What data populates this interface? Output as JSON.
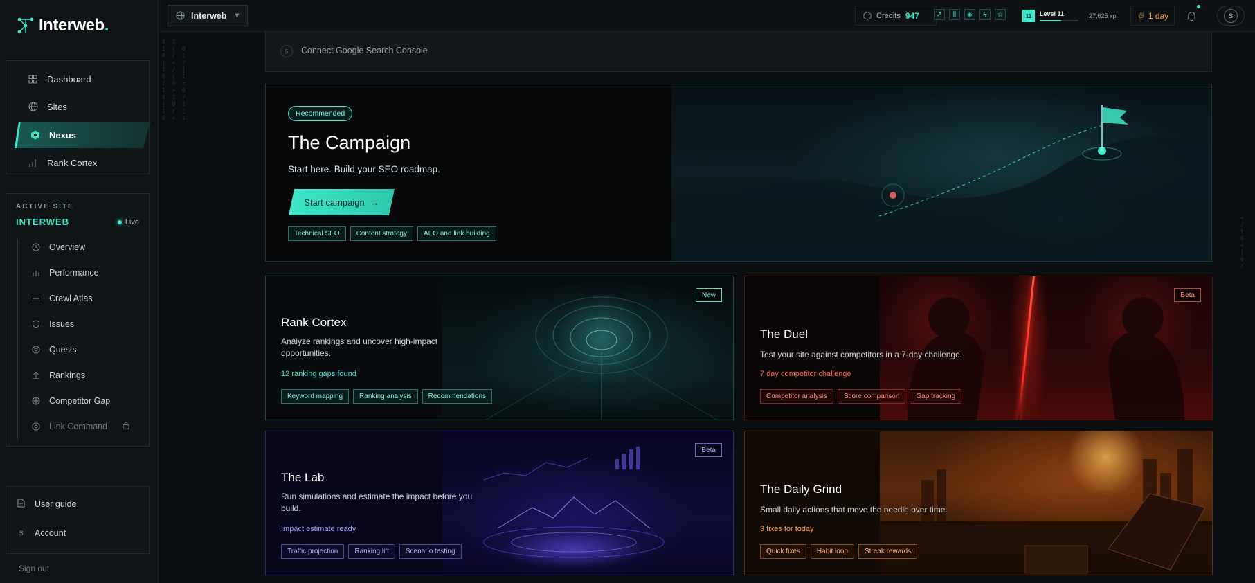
{
  "app": {
    "name": "Interweb",
    "name_dot": "."
  },
  "sidebar": {
    "nav": [
      {
        "label": "Dashboard",
        "icon": "grid-icon"
      },
      {
        "label": "Sites",
        "icon": "globe-icon"
      },
      {
        "label": "Nexus",
        "icon": "hexagon-icon",
        "active": true
      },
      {
        "label": "Rank Cortex",
        "icon": "bar-chart-icon"
      }
    ],
    "active_site": {
      "label": "ACTIVE SITE",
      "name": "INTERWEB",
      "status": "Live",
      "items": [
        {
          "label": "Overview",
          "icon": "clock-icon"
        },
        {
          "label": "Performance",
          "icon": "bar-chart-icon"
        },
        {
          "label": "Crawl Atlas",
          "icon": "list-icon"
        },
        {
          "label": "Issues",
          "icon": "shield-icon"
        },
        {
          "label": "Quests",
          "icon": "target-icon"
        },
        {
          "label": "Rankings",
          "icon": "arrow-up-icon"
        },
        {
          "label": "Competitor Gap",
          "icon": "crosshair-icon"
        },
        {
          "label": "Link Command",
          "icon": "target-icon",
          "locked": true
        }
      ]
    },
    "bottom": {
      "user_guide": "User guide",
      "account": "Account",
      "account_initial": "S",
      "sign_out": "Sign out"
    }
  },
  "topbar": {
    "site_switcher": "Interweb",
    "credits_label": "Credits",
    "credits_value": "947",
    "level_badge": "11",
    "level_label": "Level 11",
    "level_progress": 0.55,
    "xp": "27,625 xp",
    "streak": "1 day",
    "user_initial": "S"
  },
  "connect": {
    "step": "5",
    "label": "Connect Google Search Console"
  },
  "campaign": {
    "badge": "Recommended",
    "title": "The Campaign",
    "subtitle": "Start here. Build your SEO roadmap.",
    "button": "Start campaign",
    "tags": [
      "Technical SEO",
      "Content strategy",
      "AEO and link building"
    ]
  },
  "cards": {
    "rank": {
      "badge": "New",
      "title": "Rank Cortex",
      "desc": "Analyze rankings and uncover high-impact opportunities.",
      "highlight": "12 ranking gaps found",
      "tags": [
        "Keyword mapping",
        "Ranking analysis",
        "Recommendations"
      ]
    },
    "duel": {
      "badge": "Beta",
      "title": "The Duel",
      "desc": "Test your site against competitors in a 7-day challenge.",
      "highlight": "7 day competitor challenge",
      "tags": [
        "Competitor analysis",
        "Score comparison",
        "Gap tracking"
      ]
    },
    "lab": {
      "badge": "Beta",
      "title": "The Lab",
      "desc": "Run simulations and estimate the impact before you build.",
      "highlight": "Impact estimate ready",
      "tags": [
        "Traffic projection",
        "Ranking lift",
        "Scenario testing"
      ]
    },
    "daily": {
      "title": "The Daily Grind",
      "desc": "Small daily actions that move the needle over time.",
      "highlight": "3 fixes for today",
      "tags": [
        "Quick fixes",
        "Habit loop",
        "Streak rewards"
      ]
    }
  },
  "colors": {
    "accent": "#3ee6c9",
    "duel": "#ff5a40",
    "lab": "#8b84ff",
    "daily": "#ff9a4a"
  }
}
